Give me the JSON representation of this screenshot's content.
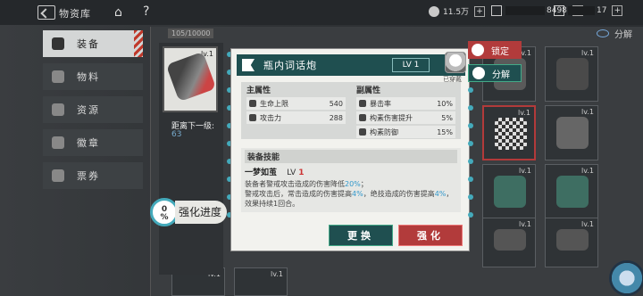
{
  "header": {
    "title": "物资库",
    "resources": [
      {
        "icon": "gear-currency-icon",
        "value": "11.5万"
      },
      {
        "icon": "crystal-icon",
        "value": "8498"
      },
      {
        "icon": "calendar-icon",
        "value": "17"
      }
    ]
  },
  "sidebar": {
    "items": [
      {
        "label": "装备",
        "icon": "equipment-icon",
        "active": true
      },
      {
        "label": "物料",
        "icon": "materials-icon",
        "active": false
      },
      {
        "label": "资源",
        "icon": "resources-icon",
        "active": false
      },
      {
        "label": "徽章",
        "icon": "badge-icon",
        "active": false
      },
      {
        "label": "票券",
        "icon": "ticket-icon",
        "active": false
      }
    ]
  },
  "inventory": {
    "capacity": "105/10000",
    "decompose_label": "分解"
  },
  "selected": {
    "lv": "lv.1",
    "dist_label": "距离下一级:",
    "dist_value": "63"
  },
  "progress": {
    "percent": "0",
    "unit": "%",
    "label": "强化进度"
  },
  "detail": {
    "name": "瓶内词话炮",
    "level": "LV 1",
    "equipped_by": "已穿戴",
    "main_attr_title": "主属性",
    "sub_attr_title": "副属性",
    "main_attrs": [
      {
        "label": "生命上限",
        "value": "540"
      },
      {
        "label": "攻击力",
        "value": "288"
      }
    ],
    "sub_attrs": [
      {
        "label": "暴击率",
        "value": "10%"
      },
      {
        "label": "构素伤害提升",
        "value": "5%"
      },
      {
        "label": "构素防御",
        "value": "15%"
      }
    ],
    "skill_title": "装备技能",
    "skill_name": "一梦如茧",
    "skill_lv_prefix": "LV",
    "skill_lv": "1",
    "skill_desc_1": "装备者警戒攻击造成的伤害降低",
    "skill_desc_1_hl": "20%",
    "skill_desc_1_end": "；",
    "skill_desc_2": "警戒攻击后，常击造成的伤害提高",
    "skill_desc_2_hl": "4%",
    "skill_desc_2_mid": "，绝技造成的伤害提高",
    "skill_desc_2_hl2": "4%",
    "skill_desc_3": "，效果持续1回合。",
    "swap_label": "更换",
    "upgrade_label": "强化",
    "lock_label": "锁定",
    "decompose_label": "分解"
  },
  "slots": [
    {
      "lv": "lv.1"
    },
    {
      "lv": "lv.1"
    },
    {
      "lv": "lv.1"
    },
    {
      "lv": "lv.1"
    },
    {
      "lv": "lv.1"
    },
    {
      "lv": "lv.1"
    },
    {
      "lv": "lv.1"
    },
    {
      "lv": "lv.1"
    },
    {
      "lv": "lv.1"
    },
    {
      "lv": "lv.1"
    }
  ]
}
